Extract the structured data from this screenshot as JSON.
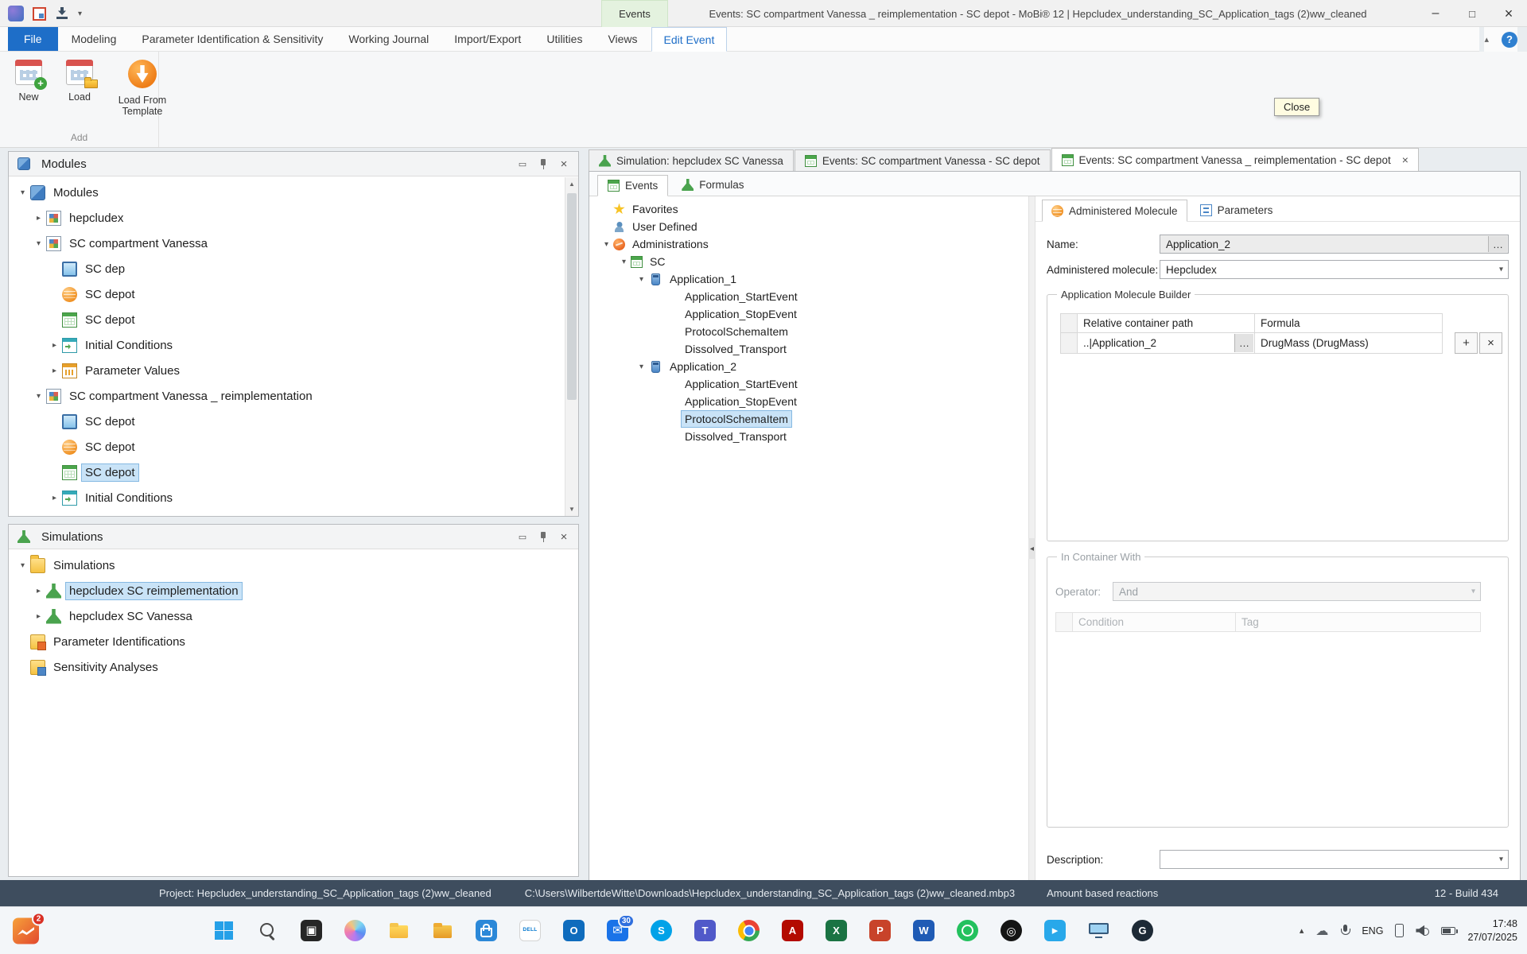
{
  "window": {
    "contextual_tab": "Events",
    "title": "Events: SC compartment Vanessa _ reimplementation - SC depot - MoBi® 12 | Hepcludex_understanding_SC_Application_tags (2)ww_cleaned"
  },
  "ribbon": {
    "tabs": [
      {
        "label": "File",
        "name": "file"
      },
      {
        "label": "Modeling"
      },
      {
        "label": "Parameter Identification & Sensitivity"
      },
      {
        "label": "Working Journal"
      },
      {
        "label": "Import/Export"
      },
      {
        "label": "Utilities"
      },
      {
        "label": "Views"
      },
      {
        "label": "Edit Event",
        "active": true
      }
    ],
    "group_label": "Add",
    "buttons": {
      "new": "New",
      "load": "Load",
      "load_template": "Load From Template"
    },
    "tooltip": "Close"
  },
  "modules_panel": {
    "title": "Modules",
    "tree": [
      {
        "label": "Modules",
        "level": 0,
        "expander": "open",
        "icon": "modules"
      },
      {
        "label": "hepcludex",
        "level": 1,
        "expander": "closed",
        "icon": "module"
      },
      {
        "label": "SC compartment Vanessa",
        "level": 1,
        "expander": "open",
        "icon": "module"
      },
      {
        "label": "SC dep",
        "level": 2,
        "expander": "none",
        "icon": "spatial"
      },
      {
        "label": "SC depot",
        "level": 2,
        "expander": "none",
        "icon": "molecule"
      },
      {
        "label": "SC depot",
        "level": 2,
        "expander": "none",
        "icon": "events"
      },
      {
        "label": "Initial Conditions",
        "level": 2,
        "expander": "closed",
        "icon": "initial"
      },
      {
        "label": "Parameter Values",
        "level": 2,
        "expander": "closed",
        "icon": "paramvalues"
      },
      {
        "label": "SC compartment Vanessa _ reimplementation",
        "level": 1,
        "expander": "open",
        "icon": "module"
      },
      {
        "label": "SC depot",
        "level": 2,
        "expander": "none",
        "icon": "spatial"
      },
      {
        "label": "SC depot",
        "level": 2,
        "expander": "none",
        "icon": "molecule"
      },
      {
        "label": "SC depot",
        "level": 2,
        "expander": "none",
        "icon": "events",
        "selected": true
      },
      {
        "label": "Initial Conditions",
        "level": 2,
        "expander": "closed",
        "icon": "initial"
      }
    ]
  },
  "simulations_panel": {
    "title": "Simulations",
    "tree": [
      {
        "label": "Simulations",
        "level": 0,
        "expander": "open",
        "icon": "folder"
      },
      {
        "label": "hepcludex SC reimplementation",
        "level": 1,
        "expander": "closed",
        "icon": "sim",
        "selected": true
      },
      {
        "label": "hepcludex SC Vanessa",
        "level": 1,
        "expander": "closed",
        "icon": "sim"
      },
      {
        "label": "Parameter Identifications",
        "level": 0,
        "expander": "none",
        "icon": "pifolder"
      },
      {
        "label": "Sensitivity Analyses",
        "level": 0,
        "expander": "none",
        "icon": "safolder"
      }
    ]
  },
  "document_tabs": [
    {
      "label": "Simulation: hepcludex SC Vanessa",
      "icon": "sim"
    },
    {
      "label": "Events: SC compartment Vanessa - SC depot",
      "icon": "events"
    },
    {
      "label": "Events: SC compartment Vanessa _ reimplementation - SC depot",
      "icon": "events",
      "active": true,
      "closable": true
    }
  ],
  "editor_tabs": [
    {
      "label": "Events",
      "icon": "events",
      "active": true
    },
    {
      "label": "Formulas",
      "icon": "formula"
    }
  ],
  "events_tree": [
    {
      "label": "Favorites",
      "level": 0,
      "expander": "none",
      "icon": "star"
    },
    {
      "label": "User Defined",
      "level": 0,
      "expander": "none",
      "icon": "user"
    },
    {
      "label": "Administrations",
      "level": 0,
      "expander": "open",
      "icon": "admin"
    },
    {
      "label": "SC",
      "level": 1,
      "expander": "open",
      "icon": "events"
    },
    {
      "label": "Application_1",
      "level": 2,
      "expander": "open",
      "icon": "vial"
    },
    {
      "label": "Application_StartEvent",
      "level": 3,
      "expander": "none",
      "icon": "none"
    },
    {
      "label": "Application_StopEvent",
      "level": 3,
      "expander": "none",
      "icon": "none"
    },
    {
      "label": "ProtocolSchemaItem",
      "level": 3,
      "expander": "none",
      "icon": "none"
    },
    {
      "label": "Dissolved_Transport",
      "level": 3,
      "expander": "none",
      "icon": "none"
    },
    {
      "label": "Application_2",
      "level": 2,
      "expander": "open",
      "icon": "vial"
    },
    {
      "label": "Application_StartEvent",
      "level": 3,
      "expander": "none",
      "icon": "none"
    },
    {
      "label": "Application_StopEvent",
      "level": 3,
      "expander": "none",
      "icon": "none"
    },
    {
      "label": "ProtocolSchemaItem",
      "level": 3,
      "expander": "none",
      "icon": "none",
      "selected": true
    },
    {
      "label": "Dissolved_Transport",
      "level": 3,
      "expander": "none",
      "icon": "none"
    }
  ],
  "props": {
    "tabs": [
      {
        "label": "Administered Molecule",
        "icon": "molecule",
        "active": true
      },
      {
        "label": "Parameters",
        "icon": "params"
      }
    ],
    "name_label": "Name:",
    "name_value": "Application_2",
    "molecule_label": "Administered molecule:",
    "molecule_value": "Hepcludex",
    "ellipsis": "…",
    "builder": {
      "title": "Application Molecule Builder",
      "columns": [
        "Relative container path",
        "Formula"
      ],
      "rows": [
        {
          "path": "..|Application_2",
          "formula": "DrugMass (DrugMass)"
        }
      ],
      "add_label": "+",
      "remove_label": "×"
    },
    "container": {
      "title": "In Container With",
      "operator_label": "Operator:",
      "operator_value": "And",
      "columns": [
        "Condition",
        "Tag"
      ]
    },
    "description_label": "Description:"
  },
  "statusbar": {
    "project": "Project: Hepcludex_understanding_SC_Application_tags (2)ww_cleaned",
    "path": "C:\\Users\\WilbertdeWitte\\Downloads\\Hepcludex_understanding_SC_Application_tags (2)ww_cleaned.mbp3",
    "mode": "Amount based reactions",
    "build": "12 - Build 434"
  },
  "taskbar": {
    "widget_badge": "2",
    "icons": [
      {
        "name": "start"
      },
      {
        "name": "search"
      },
      {
        "name": "task-view",
        "bg": "#262626",
        "glyph": "▣"
      },
      {
        "name": "copilot"
      },
      {
        "name": "explorer"
      },
      {
        "name": "project-folder"
      },
      {
        "name": "store",
        "bg": "#2b88d8"
      },
      {
        "name": "dell",
        "bg": "#ffffff",
        "glyph": "DELL",
        "fg": "#0076ce"
      },
      {
        "name": "outlook",
        "bg": "#0f6cbd",
        "glyph": "O"
      },
      {
        "name": "mail",
        "bg": "#1a73e8",
        "glyph": "✉",
        "badge": "30",
        "badge_bg": "#2f6fde"
      },
      {
        "name": "skype",
        "bg": "#00a2e8",
        "glyph": "S"
      },
      {
        "name": "teams",
        "bg": "#5059c9",
        "glyph": "T"
      },
      {
        "name": "chrome"
      },
      {
        "name": "acrobat",
        "bg": "#b30b00",
        "glyph": "A"
      },
      {
        "name": "excel",
        "bg": "#1a7343",
        "glyph": "X"
      },
      {
        "name": "powerpoint",
        "bg": "#c8432a",
        "glyph": "P"
      },
      {
        "name": "word",
        "bg": "#1f5bb5",
        "glyph": "W"
      },
      {
        "name": "whatsapp"
      },
      {
        "name": "obs",
        "bg": "#141414",
        "glyph": "◎"
      },
      {
        "name": "media-app",
        "bg": "#28a8ea",
        "glyph": "▸"
      },
      {
        "name": "display"
      },
      {
        "name": "g-app",
        "bg": "#1d2a36",
        "glyph": "G"
      }
    ],
    "tray": {
      "lang": "ENG",
      "time": "17:48",
      "date": "27/07/2025"
    }
  }
}
